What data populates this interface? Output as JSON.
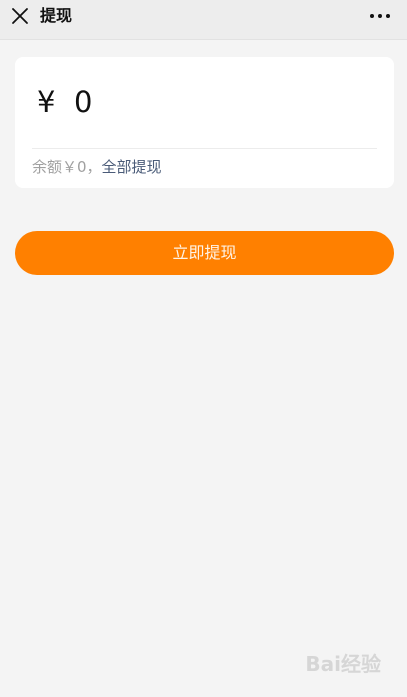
{
  "header": {
    "title": "提现",
    "close_icon": "close-icon",
    "more_icon": "more-icon"
  },
  "amount": {
    "currency_symbol": "¥",
    "value": "0"
  },
  "balance": {
    "text": "余额￥0，",
    "withdraw_all_label": "全部提现"
  },
  "actions": {
    "submit_label": "立即提现"
  },
  "watermark": {
    "text": "Bai经验"
  },
  "colors": {
    "accent": "#ff8000",
    "link": "#4a5b78",
    "background": "#f4f4f4",
    "card": "#ffffff"
  }
}
